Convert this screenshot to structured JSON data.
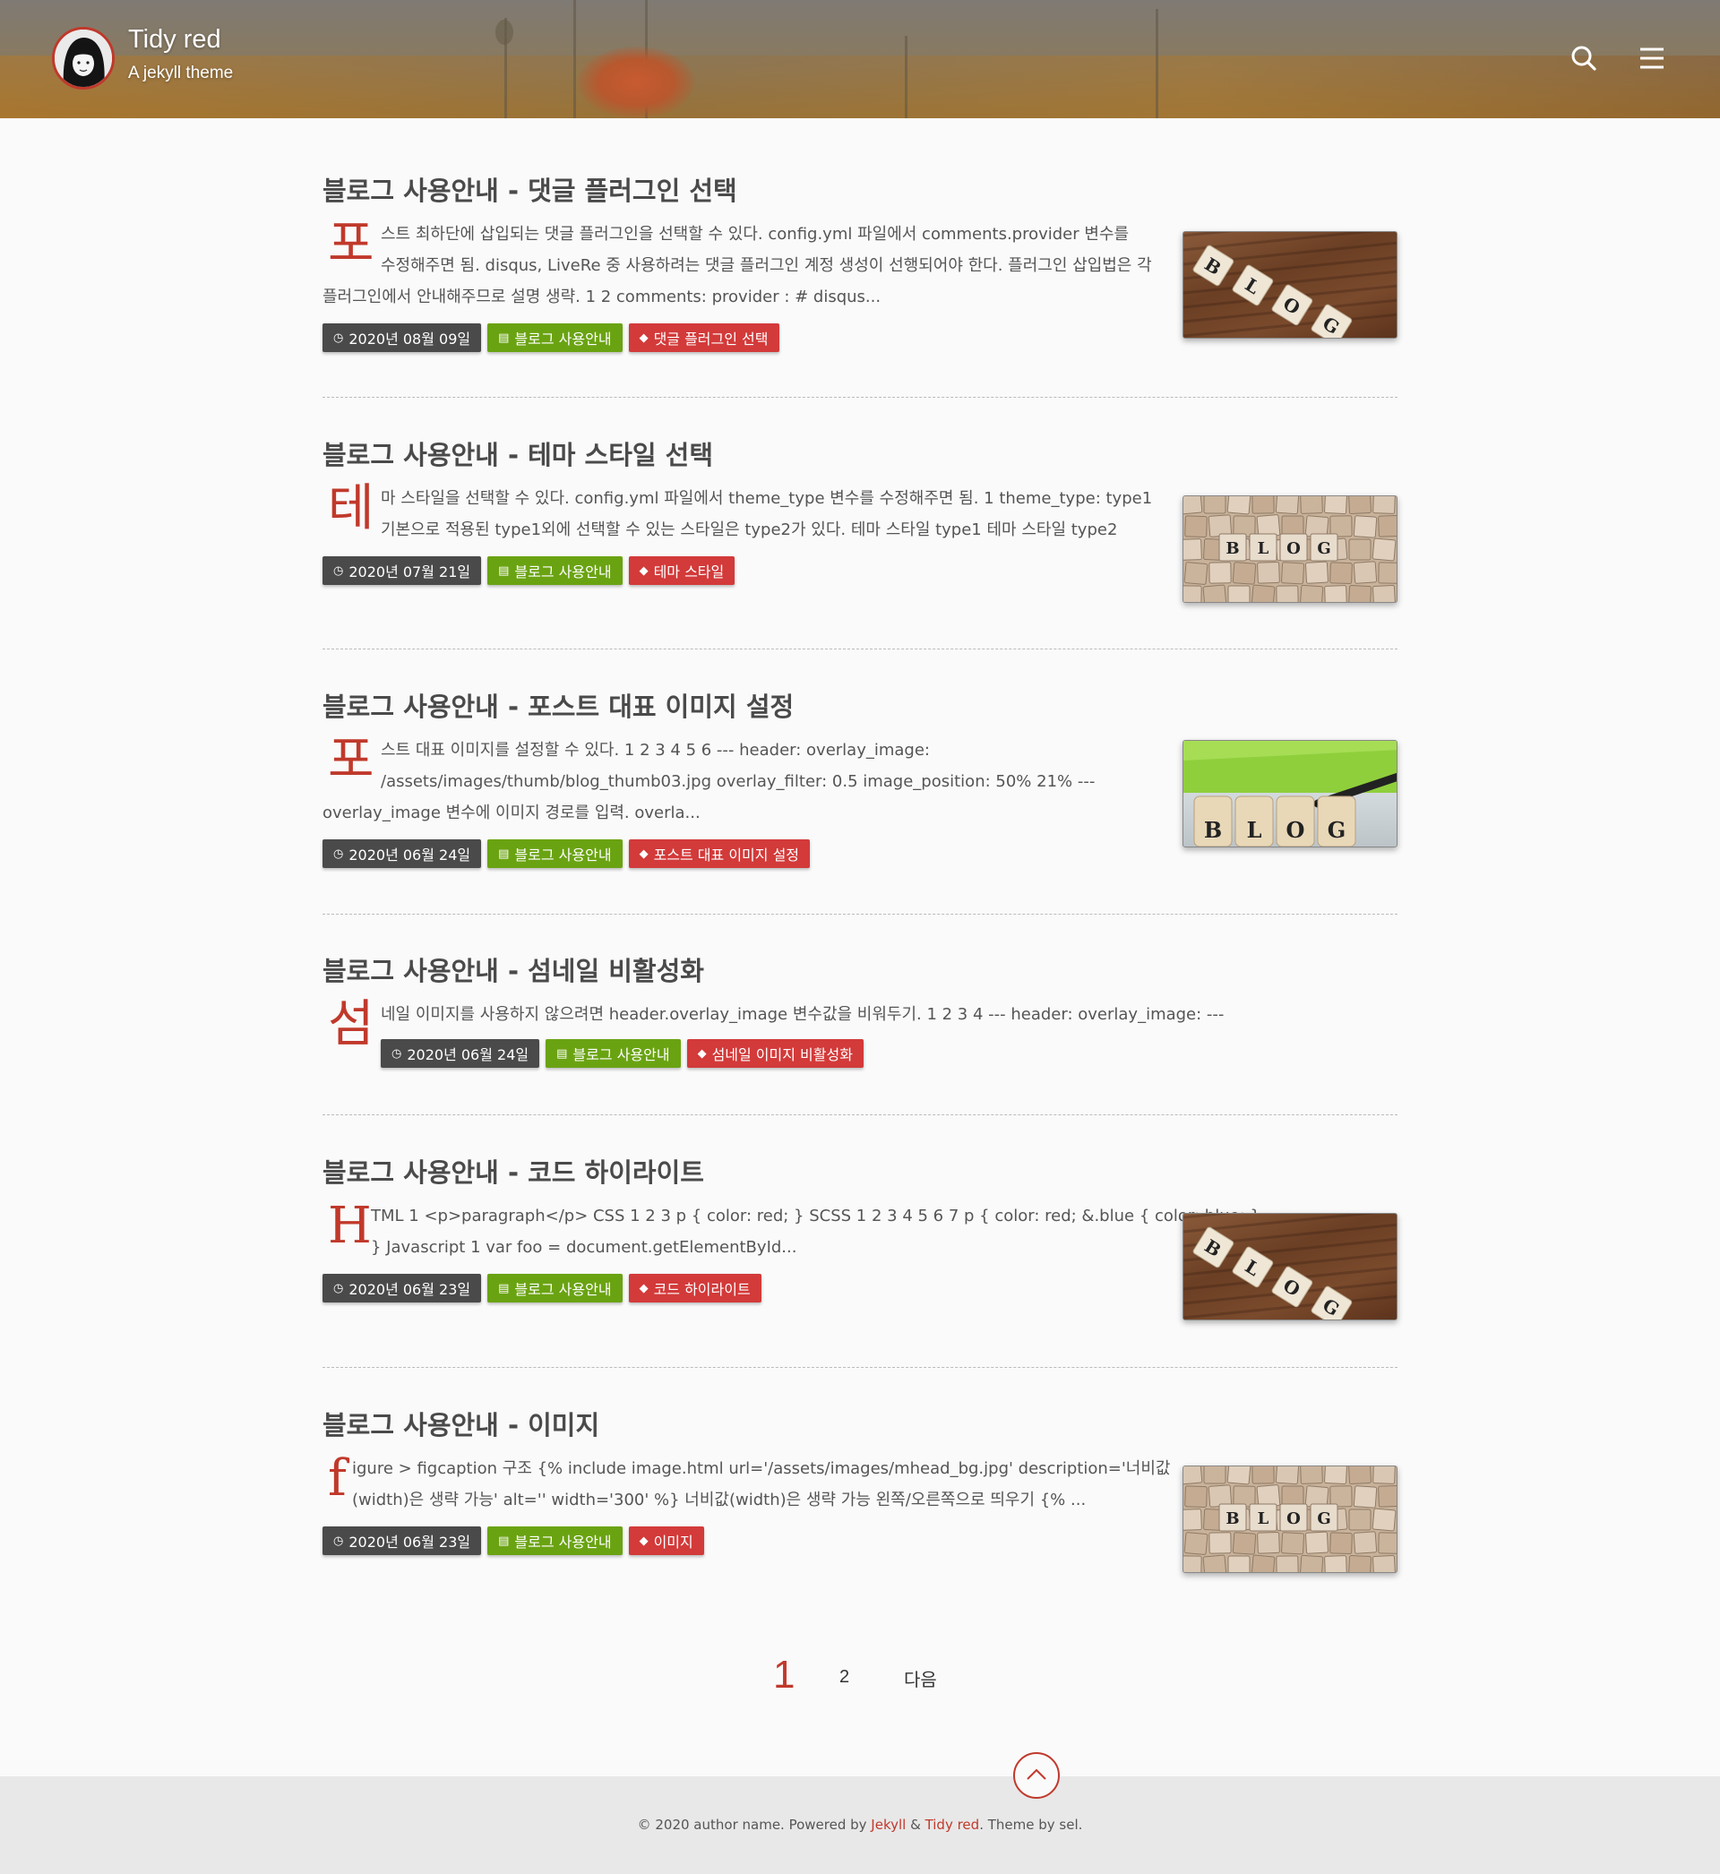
{
  "header": {
    "site_title": "Tidy red",
    "site_subtitle": "A jekyll theme",
    "search_icon": "search-icon",
    "menu_icon": "hamburger-menu-icon"
  },
  "posts": [
    {
      "title": "블로그 사용안내 - 댓글 플러그인 선택",
      "dropcap": "포",
      "excerpt_lines": [
        "스트 최하단에 삽입되는 댓글 플러그인을 선택할 수 있다. config.yml 파일에서 comments.provider 변수를",
        "수정해주면 됨. disqus, LiveRe 중 사용하려는 댓글 플러그인 계정 생성이 선행되어야 한다. 플러그인 삽입법은 각",
        "플러그인에서 안내해주므로 설명 생략. 1 2 comments: provider : # disqus..."
      ],
      "date": "2020년 08월 09일",
      "category": "블로그 사용안내",
      "tag": "댓글 플러그인 선택",
      "thumb": "wood"
    },
    {
      "title": "블로그 사용안내 - 테마 스타일 선택",
      "dropcap": "테",
      "excerpt_lines": [
        "마 스타일을 선택할 수 있다. config.yml 파일에서 theme_type 변수를 수정해주면 됨. 1 theme_type: type1",
        "기본으로 적용된 type1외에 선택할 수 있는 스타일은 type2가 있다. 테마 스타일 type1 테마 스타일 type2"
      ],
      "date": "2020년 07월 21일",
      "category": "블로그 사용안내",
      "tag": "테마 스타일",
      "thumb": "tiles"
    },
    {
      "title": "블로그 사용안내 - 포스트 대표 이미지 설정",
      "dropcap": "포",
      "excerpt_lines": [
        "스트 대표 이미지를 설정할 수 있다. 1 2 3 4 5 6 --- header: overlay_image:",
        "/assets/images/thumb/blog_thumb03.jpg overlay_filter: 0.5 image_position: 50% 21% ---",
        "overlay_image 변수에 이미지 경로를 입력. overla..."
      ],
      "date": "2020년 06월 24일",
      "category": "블로그 사용안내",
      "tag": "포스트 대표 이미지 설정",
      "thumb": "green"
    },
    {
      "title": "블로그 사용안내 - 섬네일 비활성화",
      "dropcap": "섬",
      "excerpt_lines": [
        "네일 이미지를 사용하지 않으려면 header.overlay_image 변수값을 비워두기. 1 2 3 4 --- header: overlay_image: ---"
      ],
      "date": "2020년 06월 24일",
      "category": "블로그 사용안내",
      "tag": "섬네일 이미지 비활성화",
      "thumb": "none"
    },
    {
      "title": "블로그 사용안내 - 코드 하이라이트",
      "dropcap": "H",
      "excerpt_lines": [
        "TML 1 <p>paragraph</p> CSS 1 2 3 p { color: red; } SCSS 1 2 3 4 5 6 7 p { color: red; &.blue { color: blue; }",
        "} Javascript 1 var foo = document.getElementById..."
      ],
      "date": "2020년 06월 23일",
      "category": "블로그 사용안내",
      "tag": "코드 하이라이트",
      "thumb": "wood"
    },
    {
      "title": "블로그 사용안내 - 이미지",
      "dropcap": "f",
      "excerpt_lines": [
        "igure > figcaption 구조 {% include image.html url='/assets/images/mhead_bg.jpg' description='너비값",
        "(width)은 생략 가능' alt='' width='300' %} 너비값(width)은 생략 가능 왼쪽/오른쪽으로 띄우기 {% ..."
      ],
      "date": "2020년 06월 23일",
      "category": "블로그 사용안내",
      "tag": "이미지",
      "thumb": "tiles"
    }
  ],
  "thumb_text": "BLOG",
  "pagination": {
    "current": "1",
    "page2": "2",
    "next": "다음"
  },
  "footer": {
    "prefix": "© 2020 author name. Powered by ",
    "jekyll": "Jekyll",
    "amp": " & ",
    "tidy": "Tidy red",
    "suffix": ". Theme by sel."
  },
  "colors": {
    "accent": "#c0392b",
    "date_badge": "#4a4a4a",
    "category_badge": "#6aa312",
    "tag_badge": "#d33a3a"
  }
}
